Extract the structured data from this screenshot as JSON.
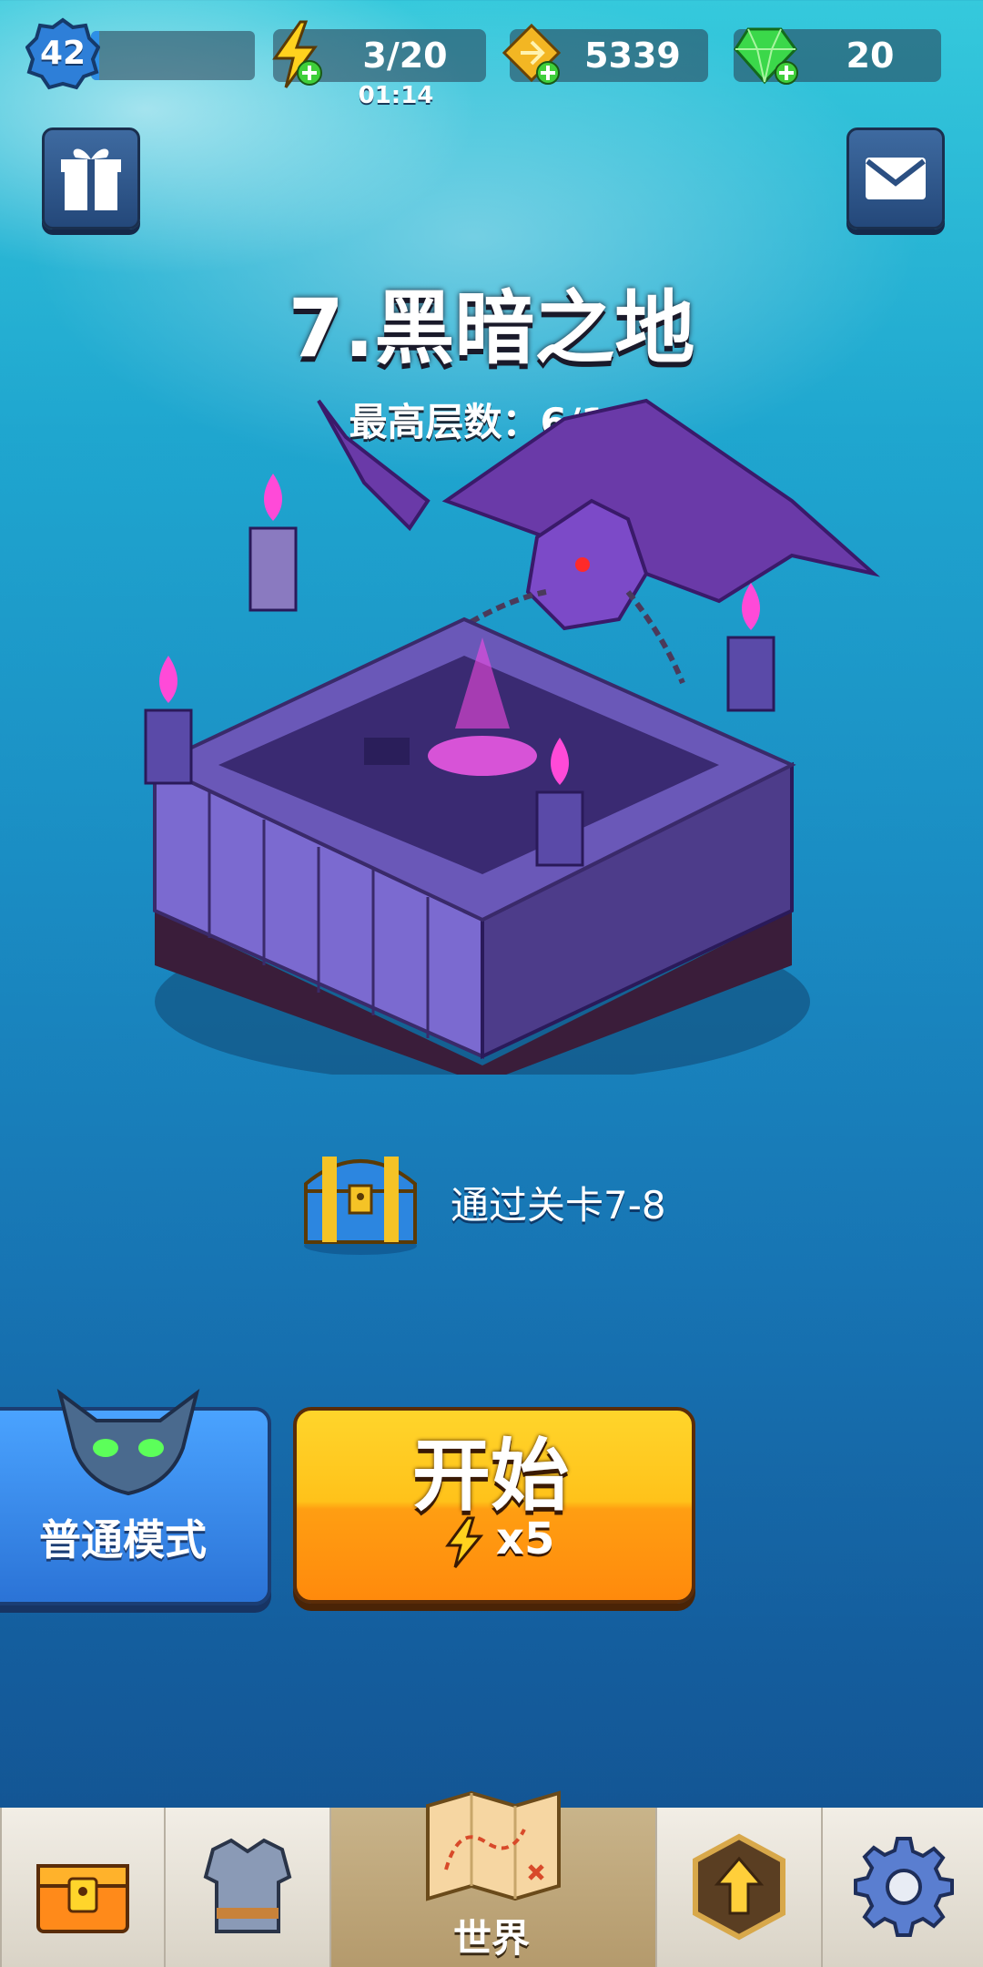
{
  "hud": {
    "level": "42",
    "xp_progress": 0.05,
    "energy": "3/20",
    "energy_timer": "01:14",
    "coins": "5339",
    "gems": "20"
  },
  "stage": {
    "title": "7.黑暗之地",
    "best_floor": "最高层数：6/10"
  },
  "reward": {
    "text": "通过关卡7-8"
  },
  "buttons": {
    "mode": "普通模式",
    "start": "开始",
    "start_cost": "x5"
  },
  "nav": {
    "active_tab_label": "世界"
  },
  "icons": {
    "gift": "gift-icon",
    "mail": "mail-icon",
    "energy": "lightning-icon",
    "coins": "coin-icon",
    "gems": "gem-icon",
    "chest": "treasure-chest-icon",
    "armor": "armor-icon",
    "map": "map-icon",
    "upgrade": "upgrade-arrow-icon",
    "settings": "gear-icon"
  }
}
